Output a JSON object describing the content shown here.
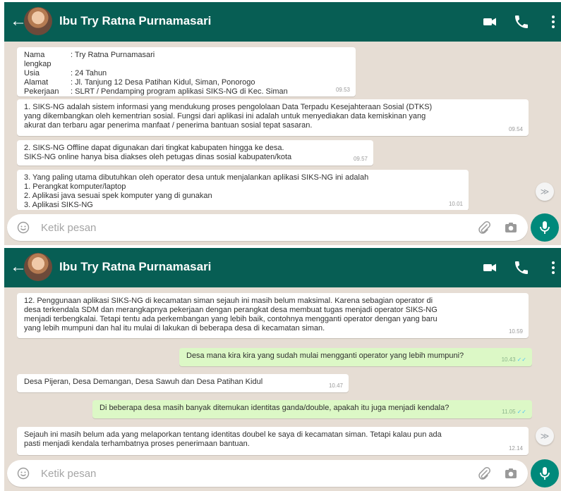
{
  "contact_name": "Ibu Try Ratna Purnamasari",
  "input_placeholder": "Ketik pesan",
  "back_glyph": "←",
  "scroll_down_glyph": "≫",
  "icons": [
    "back-arrow-icon",
    "video-call-icon",
    "voice-call-icon",
    "more-options-icon",
    "emoji-icon",
    "attach-icon",
    "camera-icon",
    "mic-icon",
    "scroll-down-icon"
  ],
  "colors": {
    "header": "#075e54",
    "chat_bg": "#e6ddd4",
    "incoming": "#ffffff",
    "outgoing": "#dcf8c6",
    "mic": "#00897b"
  },
  "panel1": {
    "profile": {
      "rows": [
        {
          "k": "Nama lengkap",
          "v": ": Try Ratna Purnamasari"
        },
        {
          "k": "Usia",
          "v": ": 24 Tahun"
        },
        {
          "k": "Alamat",
          "v": ": Jl. Tanjung 12 Desa Patihan Kidul, Siman, Ponorogo"
        },
        {
          "k": "Pekerjaan",
          "v": ": SLRT / Pendamping program aplikasi SIKS-NG di Kec. Siman"
        }
      ],
      "time": "09.53"
    },
    "msg1": {
      "text": "1. SIKS-NG adalah sistem informasi yang mendukung proses pengololaan Data Terpadu Kesejahteraan Sosial (DTKS)\nyang dikembangkan oleh kementrian sosial. Fungsi dari aplikasi ini adalah untuk menyediakan data kemiskinan yang\nakurat dan terbaru agar penerima manfaat / penerima bantuan sosial tepat sasaran.",
      "time": "09.54"
    },
    "msg2": {
      "text": "2. SIKS-NG Offline dapat digunakan dari tingkat kabupaten hingga ke desa.\nSIKS-NG online hanya bisa diakses oleh petugas dinas sosial kabupaten/kota",
      "time": "09.57"
    },
    "msg3": {
      "text": "3. Yang paling utama dibutuhkan oleh operator desa untuk menjalankan aplikasi SIKS-NG ini adalah\n1. Perangkat komputer/laptop\n2. Aplikasi java sesuai spek komputer yang di gunakan\n3. Aplikasi SIKS-NG",
      "time": "10.01"
    }
  },
  "panel2": {
    "msg1": {
      "text": "12. Penggunaan aplikasi SIKS-NG di kecamatan siman sejauh ini masih belum maksimal. Karena sebagian operator di\ndesa terkendala SDM dan merangkapnya pekerjaan dengan perangkat desa membuat tugas menjadi operator SIKS-NG\nmenjadi terbengkalai. Tetapi tentu ada perkembangan yang lebih baik, contohnya mengganti operator dengan yang baru\nyang lebih mumpuni dan hal itu mulai di lakukan di beberapa desa di kecamatan siman.",
      "time": "10.59"
    },
    "msg2": {
      "text": "Desa mana kira kira yang sudah mulai mengganti operator yang lebih mumpuni?",
      "time": "10.43"
    },
    "msg3": {
      "text": "Desa Pijeran, Desa Demangan, Desa Sawuh dan Desa Patihan Kidul",
      "time": "10.47"
    },
    "msg4": {
      "text": "Di beberapa desa masih banyak ditemukan identitas ganda/double, apakah itu juga menjadi kendala?",
      "time": "11.05"
    },
    "msg5": {
      "text": "Sejauh ini masih belum ada yang melaporkan tentang identitas doubel ke saya di kecamatan siman. Tetapi kalau pun ada\npasti menjadi kendala terhambatnya proses penerimaan bantuan.",
      "time": "12.14"
    }
  }
}
